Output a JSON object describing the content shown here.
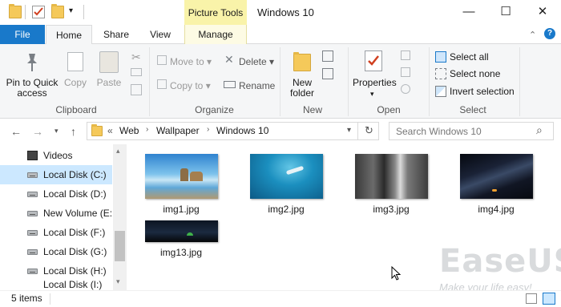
{
  "window": {
    "title": "Windows 10",
    "contextual_tab": "Picture Tools",
    "minimize_label": "—",
    "maximize_label": "☐",
    "close_label": "✕"
  },
  "tabs": [
    {
      "label": "File"
    },
    {
      "label": "Home"
    },
    {
      "label": "Share"
    },
    {
      "label": "View"
    },
    {
      "label": "Manage"
    }
  ],
  "ribbon": {
    "clipboard": {
      "pin_label": "Pin to Quick access",
      "copy_label": "Copy",
      "paste_label": "Paste",
      "group_label": "Clipboard"
    },
    "organize": {
      "move_label": "Move to",
      "copy_label": "Copy to",
      "delete_label": "Delete",
      "rename_label": "Rename",
      "group_label": "Organize"
    },
    "new": {
      "new_folder_label": "New folder",
      "group_label": "New"
    },
    "open": {
      "properties_label": "Properties",
      "group_label": "Open"
    },
    "select": {
      "select_all_label": "Select all",
      "select_none_label": "Select none",
      "invert_label": "Invert selection",
      "group_label": "Select"
    }
  },
  "address": {
    "chevron": "«",
    "segments": [
      "Web",
      "Wallpaper",
      "Windows 10"
    ],
    "search_placeholder": "Search Windows 10"
  },
  "nav": {
    "items": [
      {
        "label": "Videos"
      },
      {
        "label": "Local Disk (C:)"
      },
      {
        "label": "Local Disk (D:)"
      },
      {
        "label": "New Volume (E:)"
      },
      {
        "label": "Local Disk (F:)"
      },
      {
        "label": "Local Disk (G:)"
      },
      {
        "label": "Local Disk (H:)"
      },
      {
        "label": "Local Disk (I:)"
      }
    ]
  },
  "files": [
    {
      "name": "img1.jpg"
    },
    {
      "name": "img2.jpg"
    },
    {
      "name": "img3.jpg"
    },
    {
      "name": "img4.jpg"
    },
    {
      "name": "img13.jpg"
    }
  ],
  "status": {
    "count": "5 items"
  },
  "watermark": {
    "brand": "EaseUS",
    "tagline": "Make your life easy!"
  },
  "colors": {
    "file_tab": "#1979ca",
    "context_tab": "#f9f3a9",
    "selection": "#cce8ff"
  }
}
